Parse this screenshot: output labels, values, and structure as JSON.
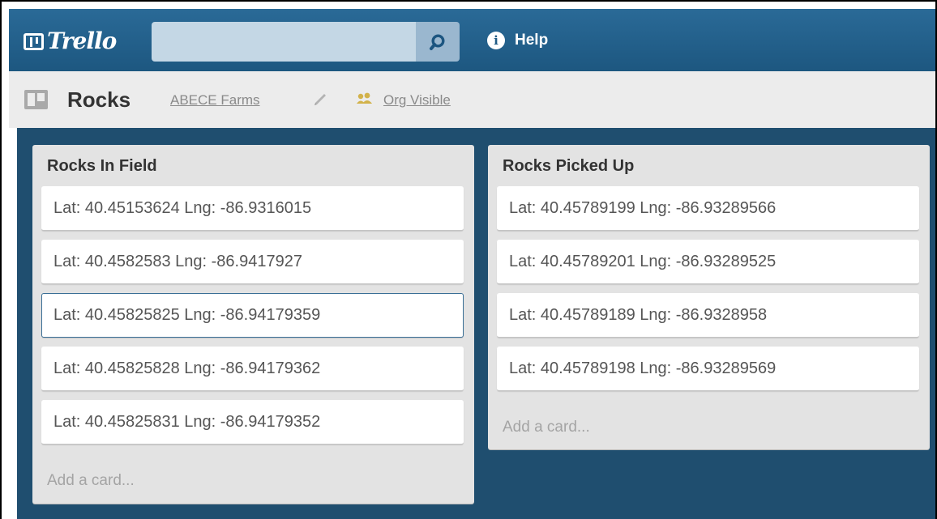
{
  "header": {
    "logo_text": "Trello",
    "search": {
      "value": "",
      "placeholder": ""
    },
    "help_label": "Help",
    "colors": {
      "header_bg": "#1f5a84",
      "search_bg": "#c4d7e5",
      "search_button_bg": "#9ab7cf"
    }
  },
  "board": {
    "title": "Rocks",
    "organization": "ABECE Farms",
    "visibility": "Org Visible",
    "colors": {
      "canvas_bg": "#1f4e6f",
      "list_bg": "#e3e3e3"
    }
  },
  "lists": [
    {
      "title": "Rocks In Field",
      "cards": [
        "Lat: 40.45153624 Lng: -86.9316015",
        "Lat: 40.4582583 Lng: -86.9417927",
        "Lat: 40.45825825 Lng: -86.94179359",
        "Lat: 40.45825828 Lng: -86.94179362",
        "Lat: 40.45825831 Lng: -86.94179352"
      ],
      "add_card_label": "Add a card..."
    },
    {
      "title": "Rocks Picked Up",
      "cards": [
        "Lat: 40.45789199 Lng: -86.93289566",
        "Lat: 40.45789201 Lng: -86.93289525",
        "Lat: 40.45789189 Lng: -86.9328958",
        "Lat: 40.45789198 Lng: -86.93289569"
      ],
      "add_card_label": "Add a card..."
    }
  ],
  "icons": {
    "logo": "trello-board-icon",
    "search": "search-icon",
    "help": "info-icon",
    "board": "board-icon",
    "edit": "pencil-icon",
    "visibility": "members-icon"
  }
}
